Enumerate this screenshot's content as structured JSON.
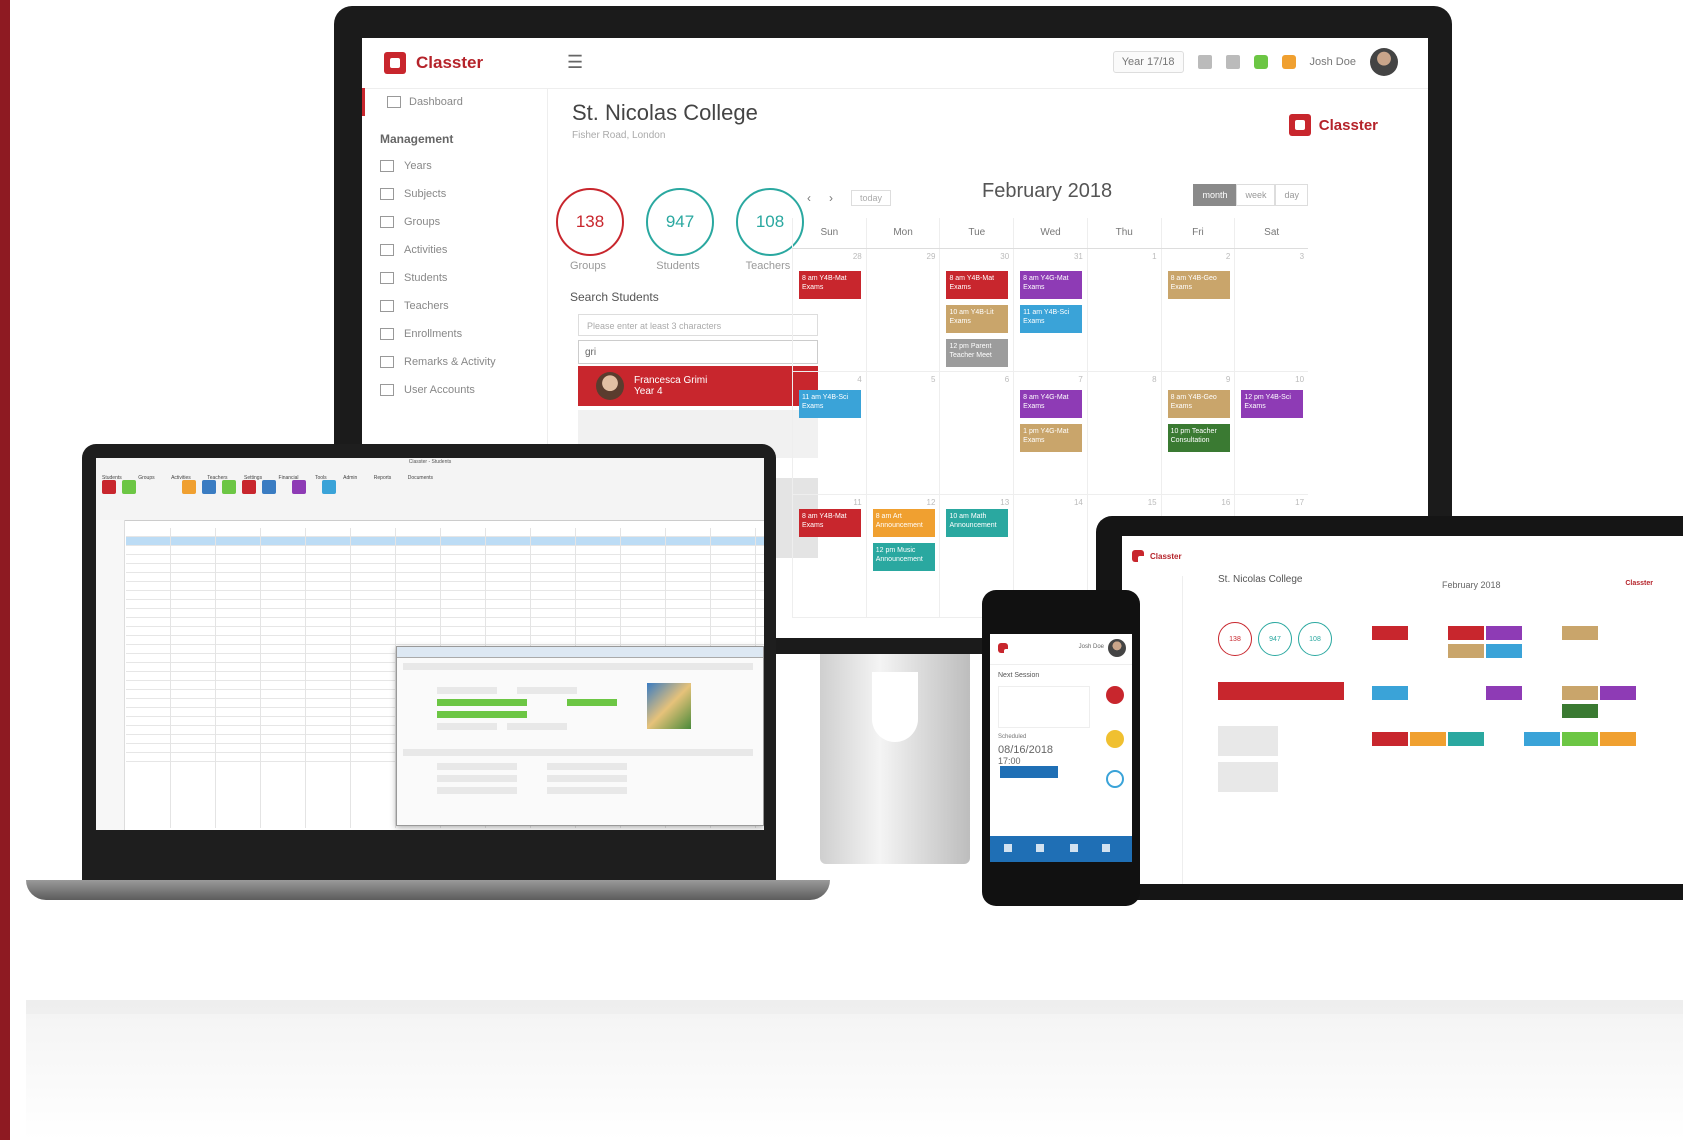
{
  "colors": {
    "brand_red": "#c8262d",
    "groups": "#c8262d",
    "students": "#2aa8a0",
    "teachers": "#2aa8a0"
  },
  "monitor": {
    "logo_text": "Classter",
    "topbar": {
      "year_select": "Year 17/18",
      "username": "Josh Doe"
    },
    "sidebar": {
      "dashboard": "Dashboard",
      "section_title": "Management",
      "items": [
        "Years",
        "Subjects",
        "Groups",
        "Activities",
        "Students",
        "Teachers",
        "Enrollments",
        "Remarks & Activity",
        "User Accounts"
      ]
    },
    "school": {
      "title": "St. Nicolas College",
      "subtitle": "Fisher Road, London"
    },
    "brand_right": "Classter",
    "stats": [
      {
        "value": "138",
        "label": "Groups"
      },
      {
        "value": "947",
        "label": "Students"
      },
      {
        "value": "108",
        "label": "Teachers"
      }
    ],
    "search": {
      "label": "Search Students",
      "placeholder": "Please enter at least 3 characters",
      "query": "gri",
      "result_name": "Francesca Grimi",
      "result_year": "Year 4"
    },
    "calendar": {
      "title": "February 2018",
      "today": "today",
      "views": [
        "month",
        "week",
        "day"
      ],
      "days": [
        "Sun",
        "Mon",
        "Tue",
        "Wed",
        "Thu",
        "Fri",
        "Sat"
      ],
      "rows": [
        [
          "28",
          "29",
          "30",
          "31",
          "1",
          "2",
          "3"
        ],
        [
          "4",
          "5",
          "6",
          "7",
          "8",
          "9",
          "10"
        ],
        [
          "11",
          "12",
          "13",
          "14",
          "15",
          "16",
          "17"
        ]
      ],
      "events": {
        "r0_sun": "8 am Y4B-Mat Exams",
        "r0_tue_a": "8 am Y4B-Mat Exams",
        "r0_tue_b": "10 am Y4B-Lit Exams",
        "r0_tue_c": "12 pm Parent Teacher Meet",
        "r0_wed_a": "8 am Y4G-Mat Exams",
        "r0_wed_b": "11 am Y4B-Sci Exams",
        "r0_fri": "8 am Y4B-Geo Exams",
        "r1_sun": "11 am Y4B-Sci Exams",
        "r1_wed_a": "8 am Y4G-Mat Exams",
        "r1_wed_b": "1 pm Y4G-Mat Exams",
        "r1_fri_a": "8 am Y4B-Geo Exams",
        "r1_fri_b": "10 pm Teacher Consultation",
        "r1_sat": "12 pm Y4B-Sci Exams",
        "r2_sun": "8 am Y4B-Mat Exams",
        "r2_mon_a": "8 am Art Announcement",
        "r2_mon_b": "12 pm Music Announcement",
        "r2_tue": "10 am Math Announcement"
      }
    }
  },
  "laptop": {
    "window_title": "Classter - Students",
    "ribbon_tabs": [
      "Students",
      "Groups",
      "Activities",
      "Teachers",
      "Settings",
      "Financial",
      "Tools",
      "Admin",
      "Reports",
      "Documents"
    ]
  },
  "tablet": {
    "logo_text": "Classter",
    "school_title": "St. Nicolas College",
    "calendar_title": "February 2018",
    "stats": [
      "138",
      "947",
      "108"
    ],
    "brand_right": "Classter"
  },
  "phone": {
    "user_label": "Josh Doe",
    "card_title": "Next Session",
    "date_label": "Scheduled",
    "date_value": "08/16/2018",
    "time_value": "17:00"
  }
}
